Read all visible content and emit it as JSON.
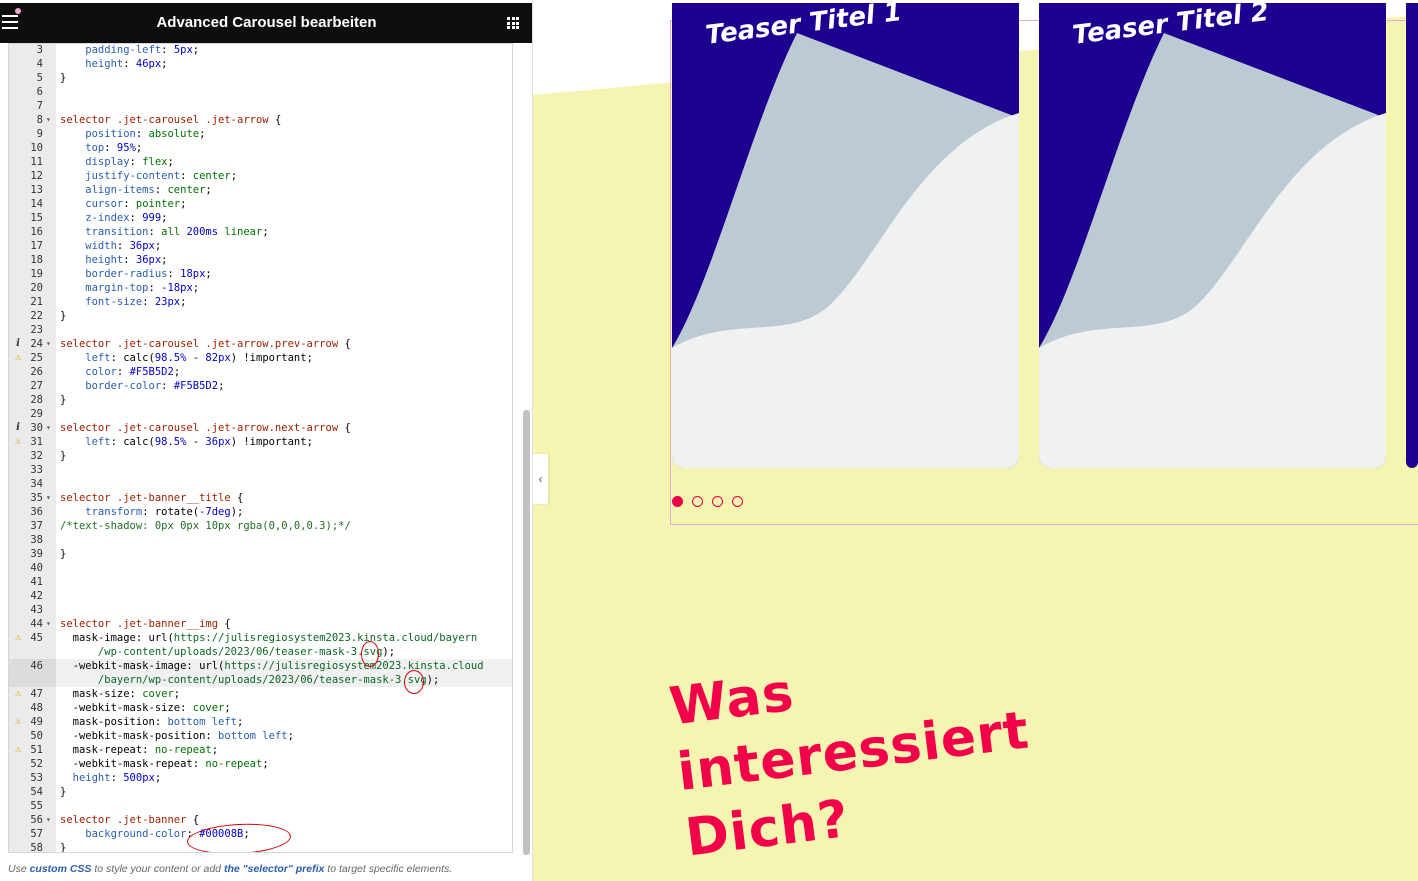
{
  "panel": {
    "title": "Advanced Carousel bearbeiten",
    "footnote": {
      "prefix": "Use ",
      "link1": "custom CSS",
      "middle": " to style your content or add ",
      "link2": "the \"selector\" prefix",
      "suffix": " to target specific elements."
    }
  },
  "editor": {
    "lines": [
      {
        "n": "3",
        "t": [
          [
            "p",
            "    padding-left"
          ],
          [
            "x",
            ": "
          ],
          [
            "u",
            "5px"
          ],
          [
            "x",
            ";"
          ]
        ]
      },
      {
        "n": "4",
        "t": [
          [
            "p",
            "    height"
          ],
          [
            "x",
            ": "
          ],
          [
            "u",
            "46px"
          ],
          [
            "x",
            ";"
          ]
        ]
      },
      {
        "n": "5",
        "t": [
          [
            "x",
            "}"
          ]
        ]
      },
      {
        "n": "6",
        "t": []
      },
      {
        "n": "7",
        "t": []
      },
      {
        "n": "8",
        "f": true,
        "t": [
          [
            "s",
            "selector .jet-carousel .jet-arrow"
          ],
          [
            "x",
            " {"
          ]
        ]
      },
      {
        "n": "9",
        "t": [
          [
            "p",
            "    position"
          ],
          [
            "x",
            ": "
          ],
          [
            "v",
            "absolute"
          ],
          [
            "x",
            ";"
          ]
        ]
      },
      {
        "n": "10",
        "t": [
          [
            "p",
            "    top"
          ],
          [
            "x",
            ": "
          ],
          [
            "u",
            "95%"
          ],
          [
            "x",
            ";"
          ]
        ]
      },
      {
        "n": "11",
        "t": [
          [
            "p",
            "    display"
          ],
          [
            "x",
            ": "
          ],
          [
            "v",
            "flex"
          ],
          [
            "x",
            ";"
          ]
        ]
      },
      {
        "n": "12",
        "t": [
          [
            "p",
            "    justify-content"
          ],
          [
            "x",
            ": "
          ],
          [
            "v",
            "center"
          ],
          [
            "x",
            ";"
          ]
        ]
      },
      {
        "n": "13",
        "t": [
          [
            "p",
            "    align-items"
          ],
          [
            "x",
            ": "
          ],
          [
            "v",
            "center"
          ],
          [
            "x",
            ";"
          ]
        ]
      },
      {
        "n": "14",
        "t": [
          [
            "p",
            "    cursor"
          ],
          [
            "x",
            ": "
          ],
          [
            "v",
            "pointer"
          ],
          [
            "x",
            ";"
          ]
        ]
      },
      {
        "n": "15",
        "t": [
          [
            "p",
            "    z-index"
          ],
          [
            "x",
            ": "
          ],
          [
            "u",
            "999"
          ],
          [
            "x",
            ";"
          ]
        ]
      },
      {
        "n": "16",
        "t": [
          [
            "p",
            "    transition"
          ],
          [
            "x",
            ": "
          ],
          [
            "v",
            "all "
          ],
          [
            "u",
            "200ms"
          ],
          [
            "v",
            " linear"
          ],
          [
            "x",
            ";"
          ]
        ]
      },
      {
        "n": "17",
        "t": [
          [
            "p",
            "    width"
          ],
          [
            "x",
            ": "
          ],
          [
            "u",
            "36px"
          ],
          [
            "x",
            ";"
          ]
        ]
      },
      {
        "n": "18",
        "t": [
          [
            "p",
            "    height"
          ],
          [
            "x",
            ": "
          ],
          [
            "u",
            "36px"
          ],
          [
            "x",
            ";"
          ]
        ]
      },
      {
        "n": "19",
        "t": [
          [
            "p",
            "    border-radius"
          ],
          [
            "x",
            ": "
          ],
          [
            "u",
            "18px"
          ],
          [
            "x",
            ";"
          ]
        ]
      },
      {
        "n": "20",
        "t": [
          [
            "p",
            "    margin-top"
          ],
          [
            "x",
            ": "
          ],
          [
            "u",
            "-18px"
          ],
          [
            "x",
            ";"
          ]
        ]
      },
      {
        "n": "21",
        "t": [
          [
            "p",
            "    font-size"
          ],
          [
            "x",
            ": "
          ],
          [
            "u",
            "23px"
          ],
          [
            "x",
            ";"
          ]
        ]
      },
      {
        "n": "22",
        "t": [
          [
            "x",
            "}"
          ]
        ]
      },
      {
        "n": "23",
        "t": []
      },
      {
        "n": "24",
        "f": true,
        "m": "info",
        "t": [
          [
            "s",
            "selector .jet-carousel .jet-arrow.prev-arrow"
          ],
          [
            "x",
            " {"
          ]
        ]
      },
      {
        "n": "25",
        "m": "warn",
        "t": [
          [
            "p",
            "    left"
          ],
          [
            "x",
            ": calc("
          ],
          [
            "u",
            "98.5%"
          ],
          [
            "x",
            " - "
          ],
          [
            "u",
            "82px"
          ],
          [
            "x",
            ") !important;"
          ]
        ]
      },
      {
        "n": "26",
        "t": [
          [
            "p",
            "    color"
          ],
          [
            "x",
            ": "
          ],
          [
            "u",
            "#F5B5D2"
          ],
          [
            "x",
            ";"
          ]
        ]
      },
      {
        "n": "27",
        "t": [
          [
            "p",
            "    border-color"
          ],
          [
            "x",
            ": "
          ],
          [
            "u",
            "#F5B5D2"
          ],
          [
            "x",
            ";"
          ]
        ]
      },
      {
        "n": "28",
        "t": [
          [
            "x",
            "}"
          ]
        ]
      },
      {
        "n": "29",
        "t": []
      },
      {
        "n": "30",
        "f": true,
        "m": "info",
        "t": [
          [
            "s",
            "selector .jet-carousel .jet-arrow.next-arrow"
          ],
          [
            "x",
            " {"
          ]
        ]
      },
      {
        "n": "31",
        "m": "warn",
        "t": [
          [
            "p",
            "    left"
          ],
          [
            "x",
            ": calc("
          ],
          [
            "u",
            "98.5%"
          ],
          [
            "x",
            " - "
          ],
          [
            "u",
            "36px"
          ],
          [
            "x",
            ") !important;"
          ]
        ]
      },
      {
        "n": "32",
        "t": [
          [
            "x",
            "}"
          ]
        ]
      },
      {
        "n": "33",
        "t": []
      },
      {
        "n": "34",
        "t": []
      },
      {
        "n": "35",
        "f": true,
        "t": [
          [
            "s",
            "selector .jet-banner__title"
          ],
          [
            "x",
            " {"
          ]
        ]
      },
      {
        "n": "36",
        "t": [
          [
            "p",
            "    transform"
          ],
          [
            "x",
            ": rotate("
          ],
          [
            "u",
            "-7deg"
          ],
          [
            "x",
            ");"
          ]
        ]
      },
      {
        "n": "37",
        "t": [
          [
            "c",
            "/*text-shadow: 0px 0px 10px rgba(0,0,0,0.3);*/"
          ]
        ]
      },
      {
        "n": "38",
        "t": []
      },
      {
        "n": "39",
        "t": [
          [
            "x",
            "}"
          ]
        ]
      },
      {
        "n": "40",
        "t": []
      },
      {
        "n": "41",
        "t": []
      },
      {
        "n": "42",
        "t": []
      },
      {
        "n": "43",
        "t": []
      },
      {
        "n": "44",
        "f": true,
        "t": [
          [
            "s",
            "selector .jet-banner__img"
          ],
          [
            "x",
            " {"
          ]
        ]
      },
      {
        "n": "45",
        "m": "warn",
        "t": [
          [
            "x",
            "  mask-image: url("
          ],
          [
            "r",
            "https://julisregiosystem2023.kinsta.cloud/bayern"
          ]
        ]
      },
      {
        "n": "",
        "t": [
          [
            "r",
            "      /wp-content/uploads/2023/06/teaser-mask-3.svg"
          ],
          [
            "x",
            ");"
          ]
        ]
      },
      {
        "n": "46",
        "a": true,
        "t": [
          [
            "x",
            "  -webkit-mask-image: url("
          ],
          [
            "r",
            "https://julisregiosystem2023.kinsta.cloud"
          ]
        ]
      },
      {
        "n": "",
        "a": true,
        "t": [
          [
            "r",
            "      /bayern/wp-content/uploads/2023/06/teaser-mask-3.svg"
          ],
          [
            "x",
            ");"
          ]
        ]
      },
      {
        "n": "47",
        "m": "warn",
        "t": [
          [
            "x",
            "  mask-size: "
          ],
          [
            "v",
            "cover"
          ],
          [
            "x",
            ";"
          ]
        ]
      },
      {
        "n": "48",
        "t": [
          [
            "x",
            "  -webkit-mask-size: "
          ],
          [
            "v",
            "cover"
          ],
          [
            "x",
            ";"
          ]
        ]
      },
      {
        "n": "49",
        "m": "warn",
        "t": [
          [
            "x",
            "  mask-position: "
          ],
          [
            "p",
            "bottom left"
          ],
          [
            "x",
            ";"
          ]
        ]
      },
      {
        "n": "50",
        "t": [
          [
            "x",
            "  -webkit-mask-position: "
          ],
          [
            "p",
            "bottom left"
          ],
          [
            "x",
            ";"
          ]
        ]
      },
      {
        "n": "51",
        "m": "warn",
        "t": [
          [
            "x",
            "  mask-repeat: "
          ],
          [
            "v",
            "no-repeat"
          ],
          [
            "x",
            ";"
          ]
        ]
      },
      {
        "n": "52",
        "t": [
          [
            "x",
            "  -webkit-mask-repeat: "
          ],
          [
            "v",
            "no-repeat"
          ],
          [
            "x",
            ";"
          ]
        ]
      },
      {
        "n": "53",
        "t": [
          [
            "p",
            "  height"
          ],
          [
            "x",
            ": "
          ],
          [
            "u",
            "500px"
          ],
          [
            "x",
            ";"
          ]
        ]
      },
      {
        "n": "54",
        "t": [
          [
            "x",
            "}"
          ]
        ]
      },
      {
        "n": "55",
        "t": []
      },
      {
        "n": "56",
        "f": true,
        "t": [
          [
            "s",
            "selector .jet-banner"
          ],
          [
            "x",
            " {"
          ]
        ]
      },
      {
        "n": "57",
        "t": [
          [
            "p",
            "    background-color"
          ],
          [
            "x",
            ": "
          ],
          [
            "u",
            "#00008B"
          ],
          [
            "x",
            ";"
          ]
        ]
      },
      {
        "n": "58",
        "t": [
          [
            "x",
            "}"
          ]
        ]
      }
    ]
  },
  "preview": {
    "cards": [
      {
        "title": "Teaser Titel 1"
      },
      {
        "title": "Teaser Titel 2"
      }
    ],
    "pagination": {
      "count": 4,
      "active": 1
    },
    "heading_lines": [
      "Was",
      "interessiert",
      "Dich?"
    ],
    "colors": {
      "card_blue": "#1d008f",
      "card_wave": "#bccbd3",
      "card_light": "#f0f1f1",
      "accent_pink": "#e8004c",
      "yellow_bg": "#f4f5b0"
    }
  }
}
